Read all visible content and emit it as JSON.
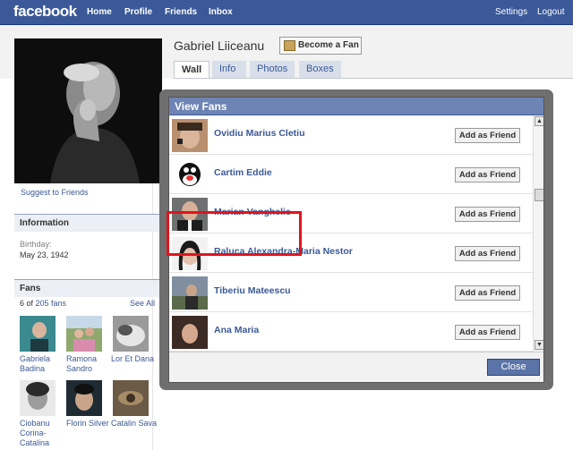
{
  "topnav": {
    "logo": "facebook",
    "links": [
      "Home",
      "Profile",
      "Friends",
      "Inbox"
    ],
    "right_links": [
      "Settings",
      "Logout"
    ]
  },
  "profile": {
    "name": "Gabriel Liiceanu",
    "become_fan_label": "Become a Fan",
    "tabs": [
      "Wall",
      "Info",
      "Photos",
      "Boxes"
    ],
    "active_tab": "Wall",
    "suggest_label": "Suggest to Friends"
  },
  "information": {
    "heading": "Information",
    "birthday_label": "Birthday:",
    "birthday_value": "May 23, 1942"
  },
  "fans_box": {
    "heading": "Fans",
    "count_prefix": "6 of ",
    "count_link": "205 fans",
    "see_all": "See All",
    "fans": [
      {
        "name": "Gabriela Badina"
      },
      {
        "name": "Ramona Sandro"
      },
      {
        "name": "Lor Et Dana"
      },
      {
        "name": "Ciobanu Corina-Catalina"
      },
      {
        "name": "Florin Silver"
      },
      {
        "name": "Catalin Sava"
      }
    ]
  },
  "dialog": {
    "title": "View Fans",
    "add_label": "Add as Friend",
    "close_label": "Close",
    "fans": [
      {
        "name": "Ovidiu Marius Cletiu",
        "avatar": "avatar-man-headset"
      },
      {
        "name": "Cartim Eddie",
        "avatar": "avatar-cartoon-cat"
      },
      {
        "name": "Marian Vanghelie",
        "avatar": "avatar-man-suit"
      },
      {
        "name": "Raluca Alexandra-Maria Nestor",
        "avatar": "avatar-woman-dark-hair"
      },
      {
        "name": "Tiberiu Mateescu",
        "avatar": "avatar-man-outdoors"
      },
      {
        "name": "Ana Maria",
        "avatar": "avatar-woman"
      }
    ],
    "highlighted": "Marian Vanghelie"
  },
  "colors": {
    "brand": "#3b5998",
    "dialog_header": "#6d84b4",
    "highlight": "#e0141e"
  }
}
